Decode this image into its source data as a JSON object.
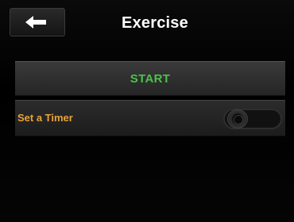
{
  "header": {
    "title": "Exercise",
    "back_icon": "back-arrow-icon"
  },
  "actions": {
    "start_label": "START"
  },
  "settings": {
    "timer_label": "Set a Timer",
    "timer_enabled": false
  },
  "colors": {
    "start_green": "#4cc04a",
    "label_orange": "#e8a33a",
    "background": "#000000"
  }
}
